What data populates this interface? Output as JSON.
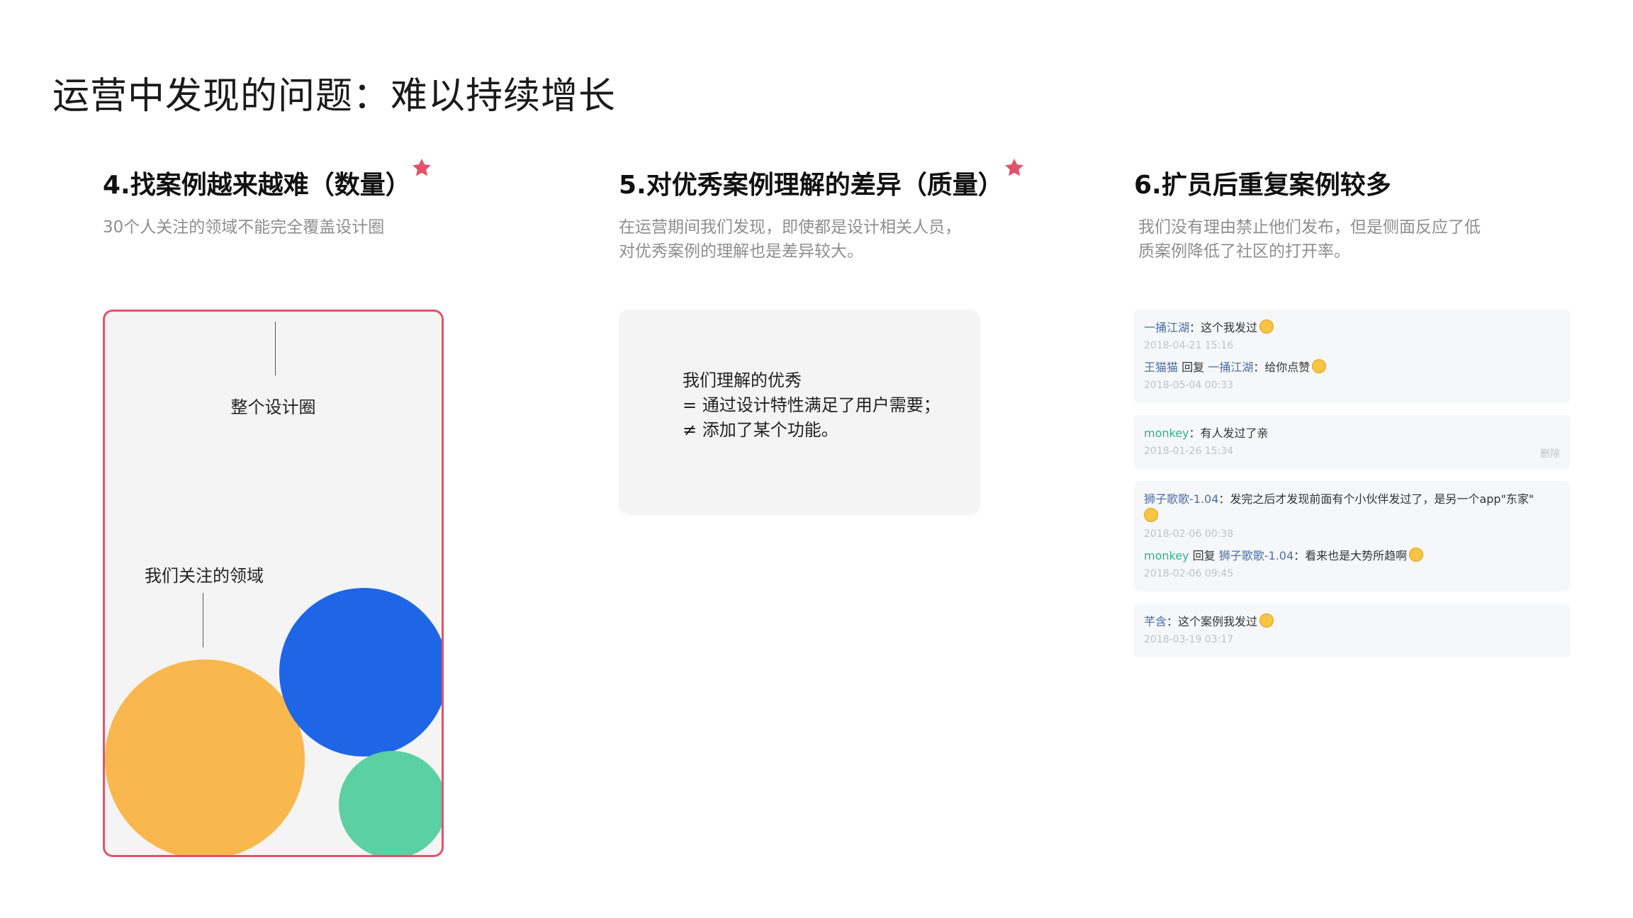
{
  "page_title": "运营中发现的问题：难以持续增长",
  "colors": {
    "accent_red": "#e0546a",
    "orange": "#f9b84d",
    "blue": "#1e66e6",
    "green": "#5bd0a3"
  },
  "sections": [
    {
      "title": "4.找案例越来越难（数量）",
      "starred": true,
      "desc_lines": [
        "30个人关注的领域不能完全覆盖设计圈"
      ]
    },
    {
      "title": "5.对优秀案例理解的差异（质量）",
      "starred": true,
      "desc_lines": [
        "在运营期间我们发现，即使都是设计相关人员，",
        "对优秀案例的理解也是差异较大。"
      ]
    },
    {
      "title": "6.扩员后重复案例较多",
      "starred": false,
      "desc_lines": [
        "我们没有理由禁止他们发布，但是侧面反应了低",
        "质案例降低了社区的打开率。"
      ]
    }
  ],
  "diagram": {
    "whole_label": "整个设计圈",
    "focus_label": "我们关注的领域"
  },
  "understanding_lines": [
    "我们理解的优秀",
    "= 通过设计特性满足了用户需要；",
    "≠ 添加了某个功能。"
  ],
  "comments": [
    {
      "has_delete": false,
      "items": [
        {
          "name": "一捅江湖",
          "reply_to": "",
          "text": "：这个我发过",
          "emoji": true,
          "time": "2018-04-21 15:16"
        },
        {
          "name": "王猫猫",
          "reply_to": "一捅江湖",
          "text": "：给你点赞",
          "emoji": true,
          "time": "2018-05-04 00:33"
        }
      ]
    },
    {
      "has_delete": true,
      "delete_label": "删除",
      "items": [
        {
          "name": "monkey",
          "reply_to": "",
          "text": "：有人发过了亲",
          "emoji": false,
          "time": "2018-01-26 15:34"
        }
      ]
    },
    {
      "has_delete": false,
      "items": [
        {
          "name": "狮子歌歌-1.04",
          "reply_to": "",
          "text": "：发完之后才发现前面有个小伙伴发过了，是另一个app\"东家\"",
          "emoji": true,
          "time": "2018-02-06 00:38"
        },
        {
          "name": "monkey",
          "reply_to": "狮子歌歌-1.04",
          "text": "：看来也是大势所趋啊",
          "emoji": true,
          "time": "2018-02-06 09:45"
        }
      ]
    },
    {
      "has_delete": false,
      "items": [
        {
          "name": "芊含",
          "reply_to": "",
          "text": "：这个案例我发过",
          "emoji": true,
          "time": "2018-03-19 03:17"
        }
      ]
    }
  ],
  "reply_word": "回复"
}
